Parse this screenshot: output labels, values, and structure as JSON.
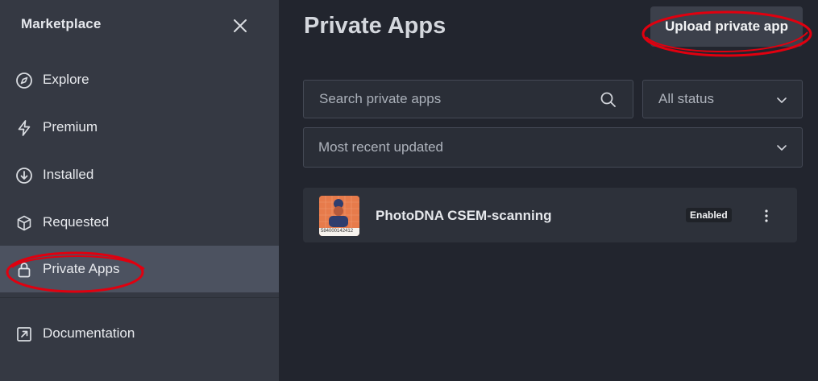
{
  "sidebar": {
    "title": "Marketplace",
    "items": [
      {
        "label": "Explore",
        "icon": "compass-icon"
      },
      {
        "label": "Premium",
        "icon": "lightning-icon"
      },
      {
        "label": "Installed",
        "icon": "download-circle-icon"
      },
      {
        "label": "Requested",
        "icon": "cube-icon"
      },
      {
        "label": "Private Apps",
        "icon": "lock-icon",
        "active": true
      },
      {
        "label": "Documentation",
        "icon": "external-link-icon"
      }
    ]
  },
  "main": {
    "title": "Private Apps",
    "upload_label": "Upload private app",
    "search": {
      "placeholder": "Search private apps",
      "value": ""
    },
    "status_filter": "All status",
    "sort": "Most recent updated",
    "apps": [
      {
        "name": "PhotoDNA CSEM-scanning",
        "status": "Enabled",
        "thumb_caption": "584000142412"
      }
    ]
  },
  "colors": {
    "sidebar_bg": "#353943",
    "active_bg": "#4c5260",
    "main_bg": "#22252e",
    "annotation": "#e0000f",
    "thumb": "#e77b4b"
  }
}
